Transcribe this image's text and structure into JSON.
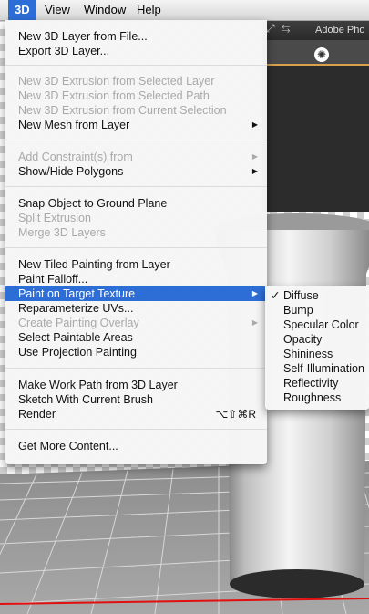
{
  "menubar": {
    "items": [
      "3D",
      "View",
      "Window",
      "Help"
    ]
  },
  "app": {
    "title": "Adobe Pho"
  },
  "menu_3d": {
    "items": [
      {
        "label": "New 3D Layer from File..."
      },
      {
        "label": "Export 3D Layer..."
      },
      {
        "label": "New 3D Extrusion from Selected Layer"
      },
      {
        "label": "New 3D Extrusion from Selected Path"
      },
      {
        "label": "New 3D Extrusion from Current Selection"
      },
      {
        "label": "New Mesh from Layer"
      },
      {
        "label": "Add Constraint(s) from"
      },
      {
        "label": "Show/Hide Polygons"
      },
      {
        "label": "Snap Object to Ground Plane"
      },
      {
        "label": "Split Extrusion"
      },
      {
        "label": "Merge 3D Layers"
      },
      {
        "label": "New Tiled Painting from Layer"
      },
      {
        "label": "Paint Falloff..."
      },
      {
        "label": "Paint on Target Texture"
      },
      {
        "label": "Reparameterize UVs..."
      },
      {
        "label": "Create Painting Overlay"
      },
      {
        "label": "Select Paintable Areas"
      },
      {
        "label": "Use Projection Painting"
      },
      {
        "label": "Make Work Path from 3D Layer"
      },
      {
        "label": "Sketch With Current Brush"
      },
      {
        "label": "Render",
        "shortcut": "⌥⇧⌘R"
      },
      {
        "label": "Get More Content..."
      }
    ]
  },
  "submenu": {
    "check_mark": "✓",
    "items": [
      "Diffuse",
      "Bump",
      "Specular Color",
      "Opacity",
      "Shininess",
      "Self-Illumination",
      "Reflectivity",
      "Roughness"
    ]
  },
  "colors": {
    "highlight": "#2d6ed6",
    "disabled_text": "#a9a9a9"
  }
}
